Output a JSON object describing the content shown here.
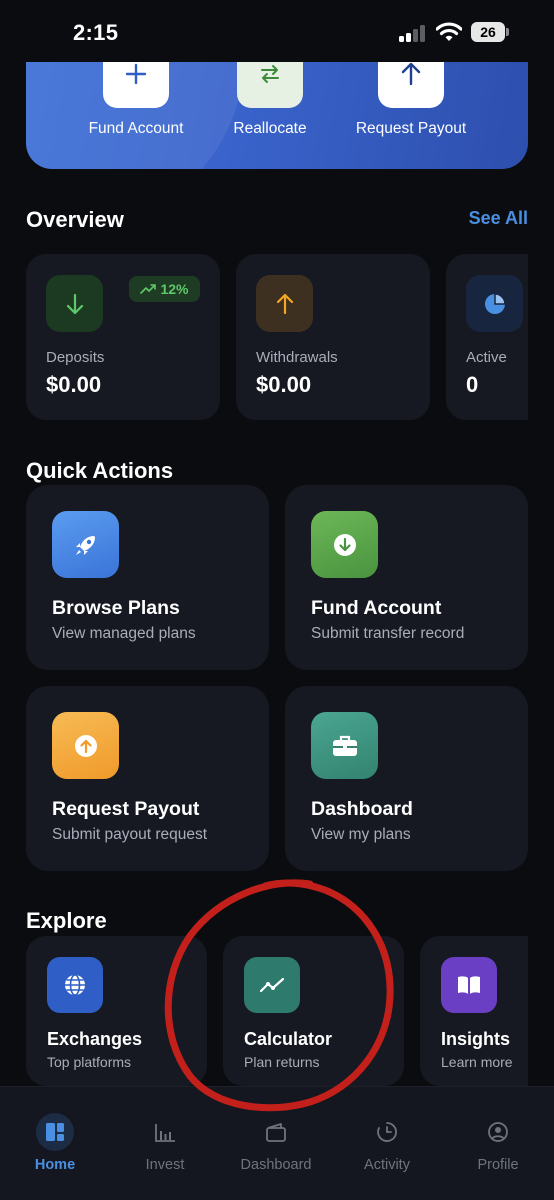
{
  "status_bar": {
    "time": "2:15",
    "battery": "26"
  },
  "hero_actions": [
    {
      "label": "Fund Account",
      "icon": "plus-icon"
    },
    {
      "label": "Reallocate",
      "icon": "swap-arrows-icon"
    },
    {
      "label": "Request Payout",
      "icon": "arrow-up-icon"
    }
  ],
  "overview": {
    "title": "Overview",
    "see_all": "See All",
    "cards": [
      {
        "label": "Deposits",
        "value": "$0.00",
        "badge": "12%",
        "icon": "arrow-down-icon",
        "color": "#4caf50"
      },
      {
        "label": "Withdrawals",
        "value": "$0.00",
        "icon": "arrow-up-icon",
        "color": "#f5a623"
      },
      {
        "label": "Active",
        "value": "0",
        "icon": "pie-chart-icon",
        "color": "#4a90e2"
      }
    ]
  },
  "quick_actions": {
    "title": "Quick Actions",
    "cards": [
      {
        "title": "Browse Plans",
        "subtitle": "View managed plans",
        "icon": "rocket-icon",
        "color": "#4a86e8"
      },
      {
        "title": "Fund Account",
        "subtitle": "Submit transfer record",
        "icon": "arrow-down-circle-icon",
        "color": "#5aa748"
      },
      {
        "title": "Request Payout",
        "subtitle": "Submit payout request",
        "icon": "arrow-up-circle-icon",
        "color": "#f5a623"
      },
      {
        "title": "Dashboard",
        "subtitle": "View my plans",
        "icon": "briefcase-icon",
        "color": "#3f9a86"
      }
    ]
  },
  "explore": {
    "title": "Explore",
    "cards": [
      {
        "title": "Exchanges",
        "subtitle": "Top platforms",
        "icon": "globe-icon",
        "color": "#2f5fc6"
      },
      {
        "title": "Calculator",
        "subtitle": "Plan returns",
        "icon": "trend-line-icon",
        "color": "#2e7a6d"
      },
      {
        "title": "Insights",
        "subtitle": "Learn more",
        "icon": "book-icon",
        "color": "#6b3fc4"
      }
    ]
  },
  "tabs": [
    {
      "label": "Home",
      "icon": "home-icon",
      "active": true
    },
    {
      "label": "Invest",
      "icon": "bar-chart-icon",
      "active": false
    },
    {
      "label": "Dashboard",
      "icon": "wallet-icon",
      "active": false
    },
    {
      "label": "Activity",
      "icon": "clock-icon",
      "active": false
    },
    {
      "label": "Profile",
      "icon": "user-icon",
      "active": false
    }
  ],
  "colors": {
    "background": "#0b0c10",
    "card": "#161922",
    "accent": "#4a90e2",
    "annotation": "#c4201b"
  }
}
